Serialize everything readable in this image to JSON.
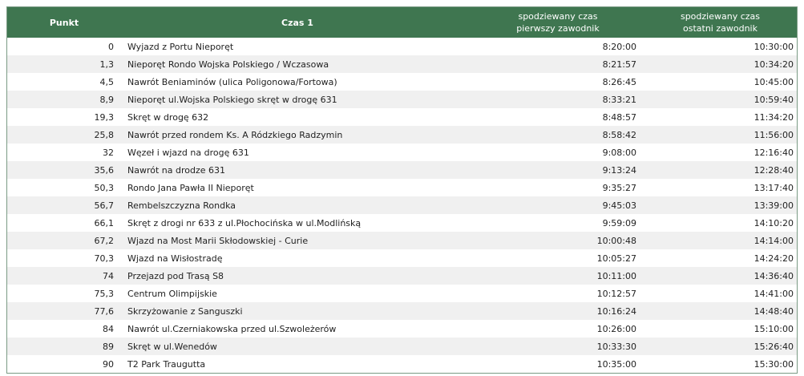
{
  "headers": {
    "punkt": "Punkt",
    "czas": "Czas 1",
    "first_line1": "spodziewany czas",
    "first_line2": "pierwszy zawodnik",
    "last_line1": "spodziewany czas",
    "last_line2": "ostatni zawodnik"
  },
  "colors": {
    "header_bg": "#3f7650",
    "row_alt": "#f0f0f0"
  },
  "rows": [
    {
      "km": "0",
      "name": "Wyjazd z Portu Nieporęt",
      "first": "8:20:00",
      "last": "10:30:00"
    },
    {
      "km": "1,3",
      "name": "Nieporęt Rondo Wojska Polskiego / Wczasowa",
      "first": "8:21:57",
      "last": "10:34:20"
    },
    {
      "km": "4,5",
      "name": "Nawrót Beniaminów (ulica Poligonowa/Fortowa)",
      "first": "8:26:45",
      "last": "10:45:00"
    },
    {
      "km": "8,9",
      "name": "Nieporęt ul.Wojska Polskiego skręt w drogę 631",
      "first": "8:33:21",
      "last": "10:59:40"
    },
    {
      "km": "19,3",
      "name": "Skręt w drogę 632",
      "first": "8:48:57",
      "last": "11:34:20"
    },
    {
      "km": "25,8",
      "name": "Nawrót przed rondem Ks. A Ródzkiego Radzymin",
      "first": "8:58:42",
      "last": "11:56:00"
    },
    {
      "km": "32",
      "name": "Węzeł i wjazd na drogę 631",
      "first": "9:08:00",
      "last": "12:16:40"
    },
    {
      "km": "35,6",
      "name": "Nawrót na drodze 631",
      "first": "9:13:24",
      "last": "12:28:40"
    },
    {
      "km": "50,3",
      "name": "Rondo Jana Pawła II Nieporęt",
      "first": "9:35:27",
      "last": "13:17:40"
    },
    {
      "km": "56,7",
      "name": "Rembelszczyzna Rondka",
      "first": "9:45:03",
      "last": "13:39:00"
    },
    {
      "km": "66,1",
      "name": "Skręt z drogi nr 633 z ul.Płochocińska w ul.Modlińską",
      "first": "9:59:09",
      "last": "14:10:20"
    },
    {
      "km": "67,2",
      "name": "Wjazd na Most Marii Skłodowskiej - Curie",
      "first": "10:00:48",
      "last": "14:14:00"
    },
    {
      "km": "70,3",
      "name": "Wjazd na Wisłostradę",
      "first": "10:05:27",
      "last": "14:24:20"
    },
    {
      "km": "74",
      "name": "Przejazd pod Trasą S8",
      "first": "10:11:00",
      "last": "14:36:40"
    },
    {
      "km": "75,3",
      "name": "Centrum Olimpijskie",
      "first": "10:12:57",
      "last": "14:41:00"
    },
    {
      "km": "77,6",
      "name": "Skrzyżowanie z Sanguszki",
      "first": "10:16:24",
      "last": "14:48:40"
    },
    {
      "km": "84",
      "name": "Nawrót ul.Czerniakowska przed ul.Szwoleżerów",
      "first": "10:26:00",
      "last": "15:10:00"
    },
    {
      "km": "89",
      "name": "Skręt w ul.Wenedów",
      "first": "10:33:30",
      "last": "15:26:40"
    },
    {
      "km": "90",
      "name": "T2 Park Traugutta",
      "first": "10:35:00",
      "last": "15:30:00"
    }
  ]
}
